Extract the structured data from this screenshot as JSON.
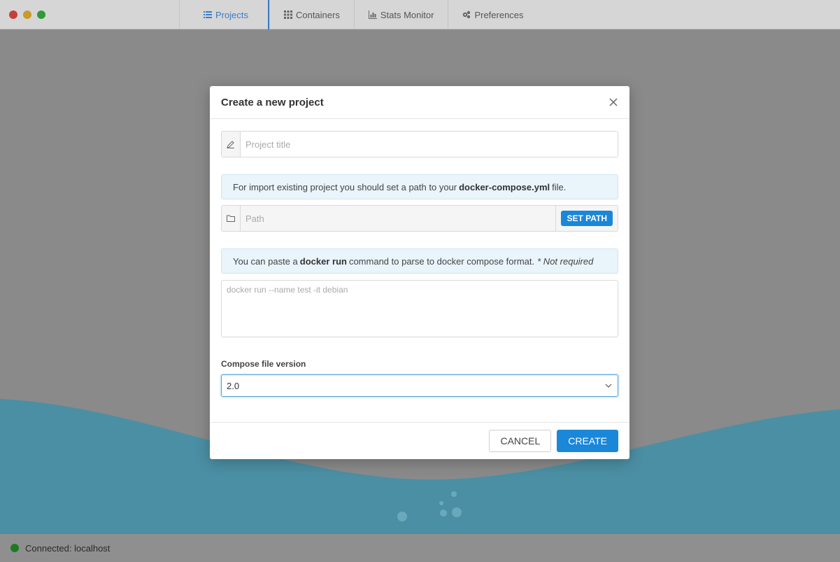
{
  "window": {
    "tabs": [
      {
        "label": "Projects",
        "icon": "list-icon"
      },
      {
        "label": "Containers",
        "icon": "grid-icon"
      },
      {
        "label": "Stats Monitor",
        "icon": "bar-chart-icon"
      },
      {
        "label": "Preferences",
        "icon": "gears-icon"
      }
    ],
    "active_tab": "Projects"
  },
  "status": {
    "text": "Connected: localhost",
    "color": "#1e7a22"
  },
  "modal": {
    "title": "Create a new project",
    "project_title_placeholder": "Project title",
    "import_info": {
      "before": "For import existing project you should set a path to your",
      "file": "docker-compose.yml",
      "after": "file."
    },
    "path_placeholder": "Path",
    "set_path_label": "SET PATH",
    "paste_info": {
      "before": "You can paste a",
      "command": "docker run",
      "after": "command to parse to docker compose format.",
      "note": "* Not required"
    },
    "docker_run_placeholder": "docker run --name test -it debian",
    "compose_label": "Compose file version",
    "compose_value": "2.0",
    "cancel_label": "CANCEL",
    "create_label": "CREATE"
  },
  "colors": {
    "accent": "#1a87d9",
    "wave": "#3f8fa8"
  }
}
